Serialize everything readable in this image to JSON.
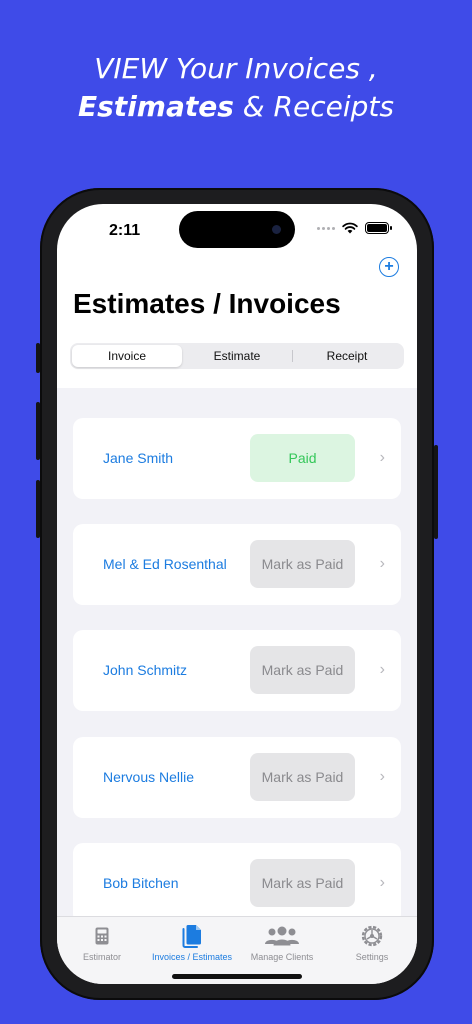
{
  "headline": {
    "line1": "VIEW Your Invoices ,",
    "line2_bold": "Estimates",
    "line2_rest": " & Receipts"
  },
  "status_bar": {
    "time": "2:11"
  },
  "header": {
    "title": "Estimates / Invoices",
    "add_icon": "plus-circle-icon"
  },
  "segments": [
    {
      "label": "Invoice",
      "selected": true
    },
    {
      "label": "Estimate",
      "selected": false
    },
    {
      "label": "Receipt",
      "selected": false
    }
  ],
  "invoices": [
    {
      "client": "Jane Smith",
      "status": "Paid",
      "paid": true
    },
    {
      "client": "Mel & Ed Rosenthal",
      "status": "Mark as Paid",
      "paid": false
    },
    {
      "client": "John Schmitz",
      "status": "Mark as Paid",
      "paid": false
    },
    {
      "client": "Nervous Nellie",
      "status": "Mark as Paid",
      "paid": false
    },
    {
      "client": "Bob Bitchen",
      "status": "Mark as Paid",
      "paid": false
    }
  ],
  "tabbar": [
    {
      "label": "Estimator",
      "icon": "calculator-icon",
      "active": false
    },
    {
      "label": "Invoices / Estimates",
      "icon": "documents-icon",
      "active": true
    },
    {
      "label": "Manage Clients",
      "icon": "people-icon",
      "active": false
    },
    {
      "label": "Settings",
      "icon": "gear-icon",
      "active": false
    }
  ],
  "colors": {
    "background": "#3f4be8",
    "accent": "#1c7ce0",
    "paid_bg": "#dcf5e1",
    "paid_text": "#34c759"
  }
}
